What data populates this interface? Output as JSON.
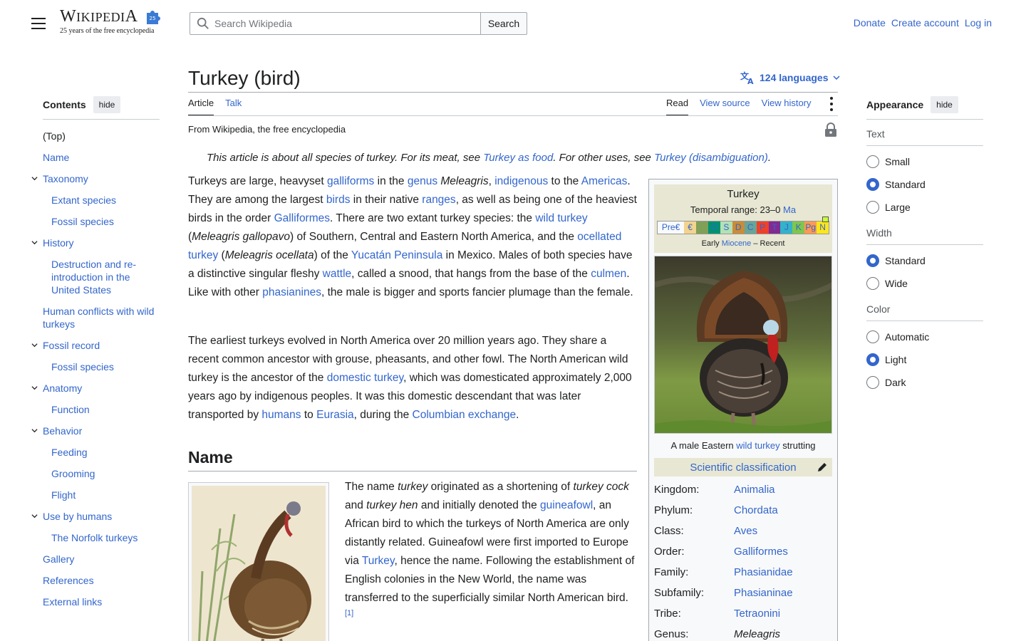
{
  "header": {
    "logo_word": "Wikipedia",
    "logo_tagline": "25 years of the free encyclopedia",
    "search_placeholder": "Search Wikipedia",
    "search_button": "Search",
    "user_links": [
      "Donate",
      "Create account",
      "Log in"
    ]
  },
  "toc": {
    "title": "Contents",
    "hide_label": "hide",
    "items": [
      {
        "label": "(Top)",
        "level": 0,
        "expandable": false
      },
      {
        "label": "Name",
        "level": 0,
        "expandable": false
      },
      {
        "label": "Taxonomy",
        "level": 0,
        "expandable": true
      },
      {
        "label": "Extant species",
        "level": 1,
        "expandable": false
      },
      {
        "label": "Fossil species",
        "level": 1,
        "expandable": false
      },
      {
        "label": "History",
        "level": 0,
        "expandable": true
      },
      {
        "label": "Destruction and re-introduction in the United States",
        "level": 1,
        "expandable": false
      },
      {
        "label": "Human conflicts with wild turkeys",
        "level": 0,
        "expandable": false
      },
      {
        "label": "Fossil record",
        "level": 0,
        "expandable": true
      },
      {
        "label": "Fossil species",
        "level": 1,
        "expandable": false
      },
      {
        "label": "Anatomy",
        "level": 0,
        "expandable": true
      },
      {
        "label": "Function",
        "level": 1,
        "expandable": false
      },
      {
        "label": "Behavior",
        "level": 0,
        "expandable": true
      },
      {
        "label": "Feeding",
        "level": 1,
        "expandable": false
      },
      {
        "label": "Grooming",
        "level": 1,
        "expandable": false
      },
      {
        "label": "Flight",
        "level": 1,
        "expandable": false
      },
      {
        "label": "Use by humans",
        "level": 0,
        "expandable": true
      },
      {
        "label": "The Norfolk turkeys",
        "level": 1,
        "expandable": false
      },
      {
        "label": "Gallery",
        "level": 0,
        "expandable": false
      },
      {
        "label": "References",
        "level": 0,
        "expandable": false
      },
      {
        "label": "External links",
        "level": 0,
        "expandable": false
      }
    ]
  },
  "page": {
    "title": "Turkey (bird)",
    "languages": "124 languages",
    "tabs_left": [
      "Article",
      "Talk"
    ],
    "tabs_right": [
      "Read",
      "View source",
      "View history"
    ],
    "tagline": "From Wikipedia, the free encyclopedia",
    "hatnote": [
      {
        "t": "This article is about all species of turkey. For its meat, see "
      },
      {
        "t": "Turkey as food",
        "link": true
      },
      {
        "t": ". For other uses, see "
      },
      {
        "t": "Turkey (disambiguation)",
        "link": true
      },
      {
        "t": "."
      }
    ],
    "section_name": "Name"
  },
  "paragraphs": [
    [
      {
        "t": "Turkeys are large, heavyset "
      },
      {
        "t": "galliforms",
        "link": true
      },
      {
        "t": " in the "
      },
      {
        "t": "genus",
        "link": true
      },
      {
        "t": " "
      },
      {
        "t": "Meleagris",
        "it": true
      },
      {
        "t": ", "
      },
      {
        "t": "indigenous",
        "link": true
      },
      {
        "t": " to the "
      },
      {
        "t": "Americas",
        "link": true
      },
      {
        "t": ". They are among the largest "
      },
      {
        "t": "birds",
        "link": true
      },
      {
        "t": " in their native "
      },
      {
        "t": "ranges",
        "link": true
      },
      {
        "t": ", as well as being one of the heaviest birds in the order "
      },
      {
        "t": "Galliformes",
        "link": true
      },
      {
        "t": ". There are two extant turkey species: the "
      },
      {
        "t": "wild turkey",
        "link": true
      },
      {
        "t": " ("
      },
      {
        "t": "Meleagris gallopavo",
        "it": true
      },
      {
        "t": ") of Southern, Central and Eastern North America, and the "
      },
      {
        "t": "ocellated turkey",
        "link": true
      },
      {
        "t": " ("
      },
      {
        "t": "Meleagris ocellata",
        "it": true
      },
      {
        "t": ") of the "
      },
      {
        "t": "Yucatán Peninsula",
        "link": true
      },
      {
        "t": " in Mexico. Males of both species have a distinctive singular fleshy "
      },
      {
        "t": "wattle",
        "link": true
      },
      {
        "t": ", called a snood, that hangs from the base of the "
      },
      {
        "t": "culmen",
        "link": true
      },
      {
        "t": ". Like with other "
      },
      {
        "t": "phasianines",
        "link": true
      },
      {
        "t": ", the male is bigger and sports fancier plumage than the female."
      }
    ],
    [
      {
        "t": "The earliest turkeys evolved in North America over 20 million years ago. They share a recent common ancestor with grouse, pheasants, and other fowl. The North American wild turkey is the ancestor of the "
      },
      {
        "t": "domestic turkey",
        "link": true
      },
      {
        "t": ", which was domesticated approximately 2,000 years ago by indigenous peoples. It was this domestic descendant that was later transported by "
      },
      {
        "t": "humans",
        "link": true
      },
      {
        "t": " to "
      },
      {
        "t": "Eurasia",
        "link": true
      },
      {
        "t": ", during the "
      },
      {
        "t": "Columbian exchange",
        "link": true
      },
      {
        "t": "."
      }
    ]
  ],
  "name_paragraph": [
    {
      "t": "The name "
    },
    {
      "t": "turkey",
      "it": true
    },
    {
      "t": " originated as a shortening of "
    },
    {
      "t": "turkey cock",
      "it": true
    },
    {
      "t": " and "
    },
    {
      "t": "turkey hen",
      "it": true
    },
    {
      "t": " and initially denoted the "
    },
    {
      "t": "guineafowl",
      "link": true
    },
    {
      "t": ", an African bird to which the turkeys of North America are only distantly related. Guineafowl were first imported to Europe via "
    },
    {
      "t": "Turkey",
      "link": true
    },
    {
      "t": ", hence the name. Following the establishment of English colonies in the New World, the name was transferred to the superficially similar North American bird."
    },
    {
      "t": "[1]",
      "link": true,
      "sup": true
    }
  ],
  "infobox": {
    "name": "Turkey",
    "range_prefix": "Temporal range: 23–0 ",
    "range_unit": "Ma",
    "timescale": [
      {
        "label": "Pre€",
        "color": "#f8f9fa"
      },
      {
        "label": "€",
        "color": "#f3d38d"
      },
      {
        "label": "",
        "color": "#7fa056"
      },
      {
        "label": "O",
        "color": "#009270"
      },
      {
        "label": "S",
        "color": "#b3e1b6"
      },
      {
        "label": "D",
        "color": "#cb8c37"
      },
      {
        "label": "C",
        "color": "#67a599"
      },
      {
        "label": "P",
        "color": "#f04028"
      },
      {
        "label": "T",
        "color": "#812b92"
      },
      {
        "label": "J",
        "color": "#34b2c9"
      },
      {
        "label": "K",
        "color": "#7fc64e"
      },
      {
        "label": "Pg",
        "color": "#fd9a52"
      },
      {
        "label": "N",
        "color": "#ffe619"
      }
    ],
    "era": [
      {
        "t": "Early "
      },
      {
        "t": "Miocene",
        "link": true
      },
      {
        "t": " – Recent"
      }
    ],
    "caption": [
      {
        "t": "A male Eastern "
      },
      {
        "t": "wild turkey",
        "link": true
      },
      {
        "t": " strutting"
      }
    ],
    "classification_label": "Scientific classification",
    "rows": [
      {
        "k": "Kingdom:",
        "v": "Animalia",
        "link": true
      },
      {
        "k": "Phylum:",
        "v": "Chordata",
        "link": true
      },
      {
        "k": "Class:",
        "v": "Aves",
        "link": true
      },
      {
        "k": "Order:",
        "v": "Galliformes",
        "link": true
      },
      {
        "k": "Family:",
        "v": "Phasianidae",
        "link": true
      },
      {
        "k": "Subfamily:",
        "v": "Phasianinae",
        "link": true
      },
      {
        "k": "Tribe:",
        "v": "Tetraonini",
        "link": true
      },
      {
        "k": "Genus:",
        "v": "Meleagris",
        "link": false,
        "it": true
      }
    ]
  },
  "appearance": {
    "title": "Appearance",
    "hide_label": "hide",
    "groups": [
      {
        "label": "Text",
        "options": [
          {
            "label": "Small",
            "on": false
          },
          {
            "label": "Standard",
            "on": true
          },
          {
            "label": "Large",
            "on": false
          }
        ]
      },
      {
        "label": "Width",
        "options": [
          {
            "label": "Standard",
            "on": true
          },
          {
            "label": "Wide",
            "on": false
          }
        ]
      },
      {
        "label": "Color",
        "options": [
          {
            "label": "Automatic",
            "on": false
          },
          {
            "label": "Light",
            "on": true
          },
          {
            "label": "Dark",
            "on": false
          }
        ]
      }
    ]
  },
  "colors": {
    "link": "#3366cc",
    "text": "#202122",
    "accent": "#3366cc"
  }
}
